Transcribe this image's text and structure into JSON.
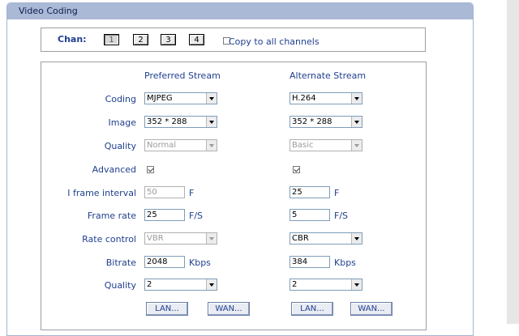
{
  "panel": {
    "title": "Video Coding"
  },
  "channels": {
    "label": "Chan:",
    "buttons": [
      "1",
      "2",
      "3",
      "4"
    ],
    "active_index": 0,
    "copy_all_label": "Copy to all channels",
    "copy_all_checked": false
  },
  "columns": {
    "preferred": "Preferred Stream",
    "alternate": "Alternate Stream"
  },
  "rows": {
    "coding": {
      "label": "Coding",
      "preferred": "MJPEG",
      "alternate": "H.264"
    },
    "image": {
      "label": "Image",
      "preferred": "352 * 288",
      "alternate": "352 * 288"
    },
    "quality_preset": {
      "label": "Quality",
      "preferred": "Normal",
      "alternate": "Basic"
    },
    "advanced": {
      "label": "Advanced",
      "preferred_checked": true,
      "alternate_checked": true
    },
    "iframe": {
      "label": "I frame interval",
      "preferred": "50",
      "alternate": "25",
      "unit": "F"
    },
    "framerate": {
      "label": "Frame rate",
      "preferred": "25",
      "alternate": "5",
      "unit": "F/S"
    },
    "ratecontrol": {
      "label": "Rate control",
      "preferred": "VBR",
      "alternate": "CBR"
    },
    "bitrate": {
      "label": "Bitrate",
      "preferred": "2048",
      "alternate": "384",
      "unit": "Kbps"
    },
    "quality_level": {
      "label": "Quality",
      "preferred": "2",
      "alternate": "2"
    }
  },
  "buttons": {
    "lan": "LAN...",
    "wan": "WAN..."
  }
}
